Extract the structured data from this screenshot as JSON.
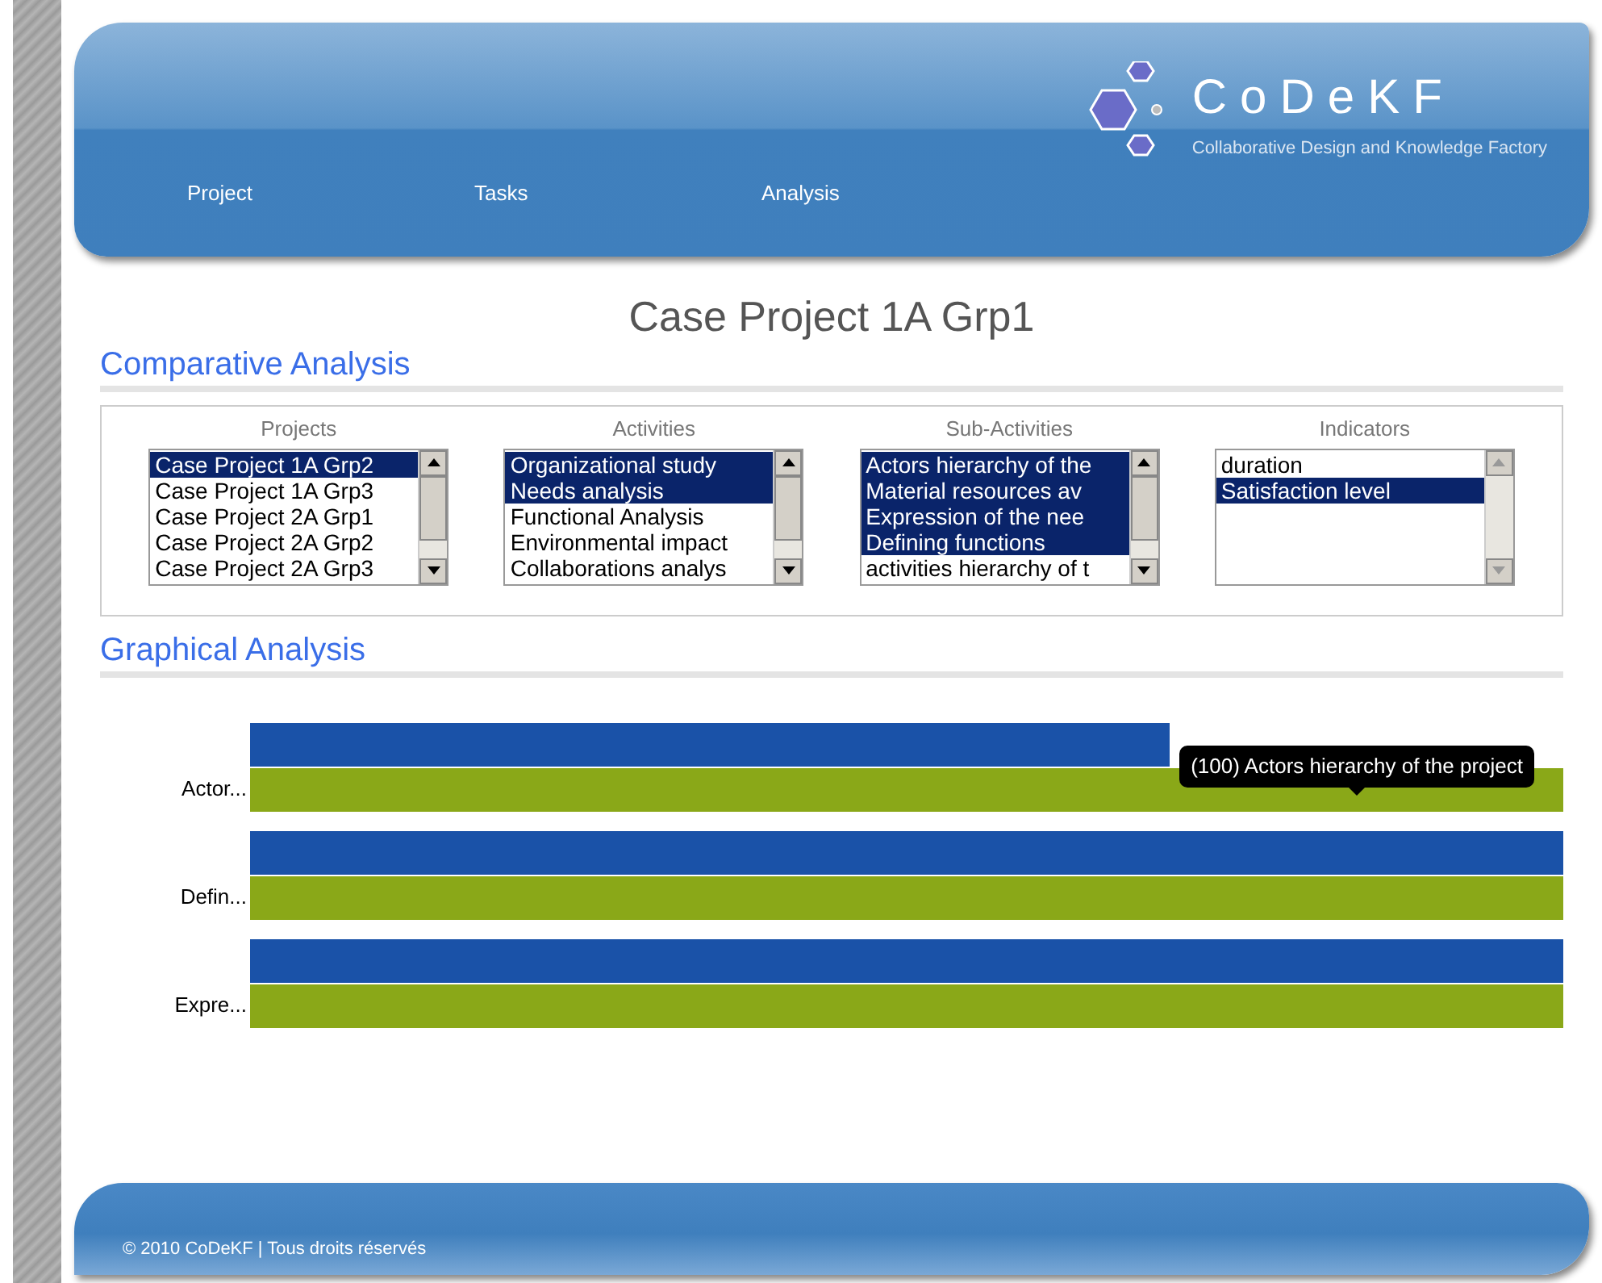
{
  "header": {
    "logo": "CoDeKF",
    "tagline": "Collaborative Design and Knowledge Factory",
    "nav": [
      {
        "label": "Project"
      },
      {
        "label": "Tasks"
      },
      {
        "label": "Analysis"
      }
    ]
  },
  "page_title": "Case Project 1A Grp1",
  "comparative": {
    "heading": "Comparative Analysis",
    "lists": [
      {
        "label": "Projects",
        "items": [
          {
            "text": "Case Project 1A Grp2",
            "selected": true
          },
          {
            "text": "Case Project 1A Grp3",
            "selected": false
          },
          {
            "text": "Case Project 2A Grp1",
            "selected": false
          },
          {
            "text": "Case Project 2A Grp2",
            "selected": false
          },
          {
            "text": "Case Project 2A Grp3",
            "selected": false
          }
        ]
      },
      {
        "label": "Activities",
        "items": [
          {
            "text": "Organizational study",
            "selected": true
          },
          {
            "text": "Needs analysis",
            "selected": true
          },
          {
            "text": "Functional Analysis",
            "selected": false
          },
          {
            "text": "Environmental impact",
            "selected": false
          },
          {
            "text": "Collaborations analys",
            "selected": false
          }
        ]
      },
      {
        "label": "Sub-Activities",
        "items": [
          {
            "text": "Actors hierarchy of the",
            "selected": true
          },
          {
            "text": "Material resources av",
            "selected": true
          },
          {
            "text": "Expression of the nee",
            "selected": true
          },
          {
            "text": "Defining functions",
            "selected": true
          },
          {
            "text": "activities hierarchy of t",
            "selected": false
          }
        ]
      },
      {
        "label": "Indicators",
        "items": [
          {
            "text": "duration",
            "selected": false
          },
          {
            "text": "Satisfaction level",
            "selected": true
          }
        ]
      }
    ]
  },
  "graphical": {
    "heading": "Graphical Analysis",
    "bar_labels": [
      "Actor...",
      "Defin...",
      "Expre..."
    ],
    "tooltip": "(100) Actors hierarchy of the project"
  },
  "footer": {
    "copyright": "© 2010  CoDeKF | Tous droits réservés"
  }
}
